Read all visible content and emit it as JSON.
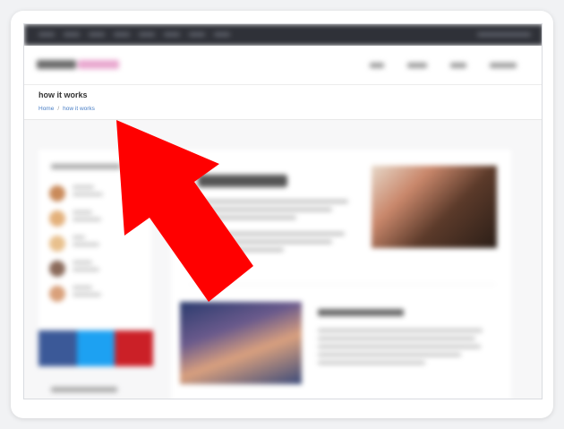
{
  "page": {
    "title": "how it works",
    "breadcrumb": {
      "home": "Home",
      "separator": "/",
      "current": "how it works"
    }
  },
  "colors": {
    "arrow": "#ff0000",
    "breadcrumb_link": "#4a7fc6",
    "topbar": "#2f3138",
    "logo_accent": "#e9a7cf"
  },
  "annotation": {
    "icon": "red-arrow-pointer"
  }
}
